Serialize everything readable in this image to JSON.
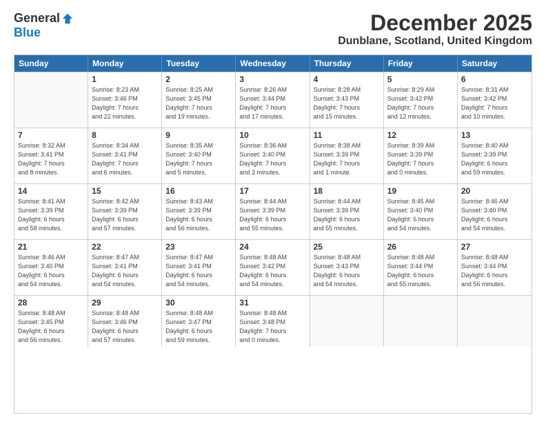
{
  "logo": {
    "general": "General",
    "blue": "Blue"
  },
  "title": "December 2025",
  "location": "Dunblane, Scotland, United Kingdom",
  "header_days": [
    "Sunday",
    "Monday",
    "Tuesday",
    "Wednesday",
    "Thursday",
    "Friday",
    "Saturday"
  ],
  "weeks": [
    [
      {
        "day": "",
        "info": ""
      },
      {
        "day": "1",
        "info": "Sunrise: 8:23 AM\nSunset: 3:46 PM\nDaylight: 7 hours\nand 22 minutes."
      },
      {
        "day": "2",
        "info": "Sunrise: 8:25 AM\nSunset: 3:45 PM\nDaylight: 7 hours\nand 19 minutes."
      },
      {
        "day": "3",
        "info": "Sunrise: 8:26 AM\nSunset: 3:44 PM\nDaylight: 7 hours\nand 17 minutes."
      },
      {
        "day": "4",
        "info": "Sunrise: 8:28 AM\nSunset: 3:43 PM\nDaylight: 7 hours\nand 15 minutes."
      },
      {
        "day": "5",
        "info": "Sunrise: 8:29 AM\nSunset: 3:42 PM\nDaylight: 7 hours\nand 12 minutes."
      },
      {
        "day": "6",
        "info": "Sunrise: 8:31 AM\nSunset: 3:42 PM\nDaylight: 7 hours\nand 10 minutes."
      }
    ],
    [
      {
        "day": "7",
        "info": "Sunrise: 8:32 AM\nSunset: 3:41 PM\nDaylight: 7 hours\nand 8 minutes."
      },
      {
        "day": "8",
        "info": "Sunrise: 8:34 AM\nSunset: 3:41 PM\nDaylight: 7 hours\nand 6 minutes."
      },
      {
        "day": "9",
        "info": "Sunrise: 8:35 AM\nSunset: 3:40 PM\nDaylight: 7 hours\nand 5 minutes."
      },
      {
        "day": "10",
        "info": "Sunrise: 8:36 AM\nSunset: 3:40 PM\nDaylight: 7 hours\nand 3 minutes."
      },
      {
        "day": "11",
        "info": "Sunrise: 8:38 AM\nSunset: 3:39 PM\nDaylight: 7 hours\nand 1 minute."
      },
      {
        "day": "12",
        "info": "Sunrise: 8:39 AM\nSunset: 3:39 PM\nDaylight: 7 hours\nand 0 minutes."
      },
      {
        "day": "13",
        "info": "Sunrise: 8:40 AM\nSunset: 3:39 PM\nDaylight: 6 hours\nand 59 minutes."
      }
    ],
    [
      {
        "day": "14",
        "info": "Sunrise: 8:41 AM\nSunset: 3:39 PM\nDaylight: 6 hours\nand 58 minutes."
      },
      {
        "day": "15",
        "info": "Sunrise: 8:42 AM\nSunset: 3:39 PM\nDaylight: 6 hours\nand 57 minutes."
      },
      {
        "day": "16",
        "info": "Sunrise: 8:43 AM\nSunset: 3:39 PM\nDaylight: 6 hours\nand 56 minutes."
      },
      {
        "day": "17",
        "info": "Sunrise: 8:44 AM\nSunset: 3:39 PM\nDaylight: 6 hours\nand 55 minutes."
      },
      {
        "day": "18",
        "info": "Sunrise: 8:44 AM\nSunset: 3:39 PM\nDaylight: 6 hours\nand 55 minutes."
      },
      {
        "day": "19",
        "info": "Sunrise: 8:45 AM\nSunset: 3:40 PM\nDaylight: 6 hours\nand 54 minutes."
      },
      {
        "day": "20",
        "info": "Sunrise: 8:46 AM\nSunset: 3:40 PM\nDaylight: 6 hours\nand 54 minutes."
      }
    ],
    [
      {
        "day": "21",
        "info": "Sunrise: 8:46 AM\nSunset: 3:40 PM\nDaylight: 6 hours\nand 54 minutes."
      },
      {
        "day": "22",
        "info": "Sunrise: 8:47 AM\nSunset: 3:41 PM\nDaylight: 6 hours\nand 54 minutes."
      },
      {
        "day": "23",
        "info": "Sunrise: 8:47 AM\nSunset: 3:41 PM\nDaylight: 6 hours\nand 54 minutes."
      },
      {
        "day": "24",
        "info": "Sunrise: 8:48 AM\nSunset: 3:42 PM\nDaylight: 6 hours\nand 54 minutes."
      },
      {
        "day": "25",
        "info": "Sunrise: 8:48 AM\nSunset: 3:43 PM\nDaylight: 6 hours\nand 54 minutes."
      },
      {
        "day": "26",
        "info": "Sunrise: 8:48 AM\nSunset: 3:44 PM\nDaylight: 6 hours\nand 55 minutes."
      },
      {
        "day": "27",
        "info": "Sunrise: 8:48 AM\nSunset: 3:44 PM\nDaylight: 6 hours\nand 56 minutes."
      }
    ],
    [
      {
        "day": "28",
        "info": "Sunrise: 8:48 AM\nSunset: 3:45 PM\nDaylight: 6 hours\nand 56 minutes."
      },
      {
        "day": "29",
        "info": "Sunrise: 8:48 AM\nSunset: 3:46 PM\nDaylight: 6 hours\nand 57 minutes."
      },
      {
        "day": "30",
        "info": "Sunrise: 8:48 AM\nSunset: 3:47 PM\nDaylight: 6 hours\nand 59 minutes."
      },
      {
        "day": "31",
        "info": "Sunrise: 8:48 AM\nSunset: 3:48 PM\nDaylight: 7 hours\nand 0 minutes."
      },
      {
        "day": "",
        "info": ""
      },
      {
        "day": "",
        "info": ""
      },
      {
        "day": "",
        "info": ""
      }
    ]
  ]
}
